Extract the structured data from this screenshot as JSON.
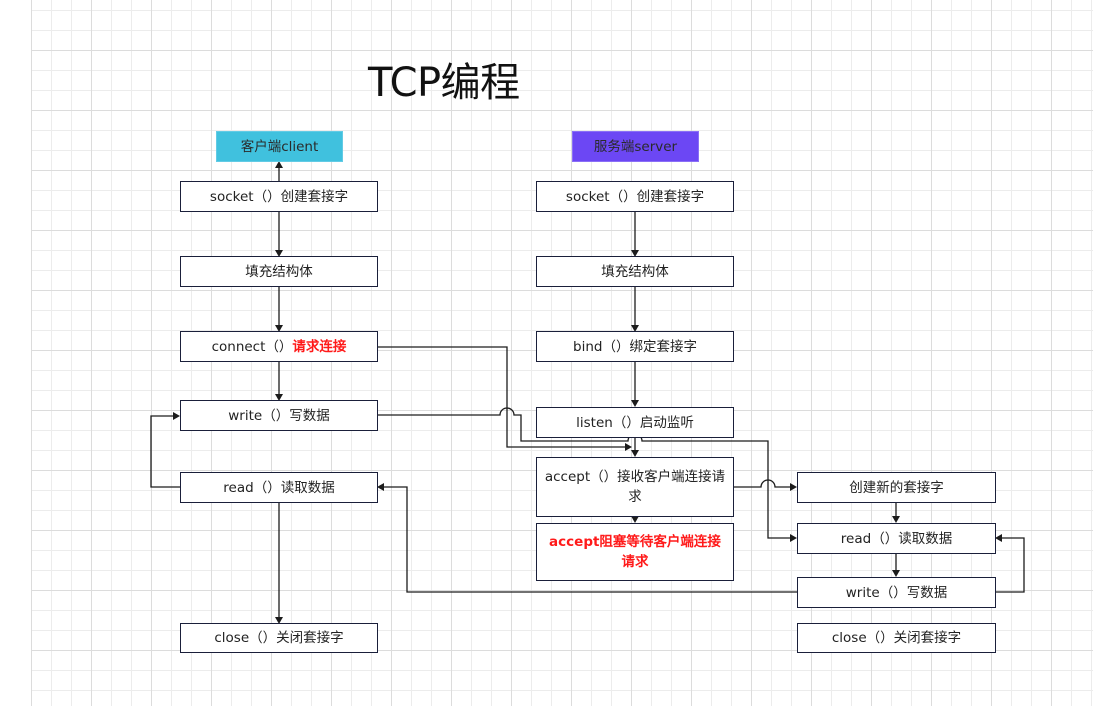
{
  "title": "TCP编程",
  "client": {
    "header": "客户端client",
    "steps": [
      {
        "id": "c-socket",
        "call": "socket（）",
        "desc": "创建套接字"
      },
      {
        "id": "c-fill",
        "call": "",
        "desc": "填充结构体"
      },
      {
        "id": "c-connect",
        "call": "connect（）",
        "desc": "请求连接",
        "highlight": true
      },
      {
        "id": "c-write",
        "call": "write（）",
        "desc": "写数据"
      },
      {
        "id": "c-read",
        "call": "read（）",
        "desc": "读取数据"
      },
      {
        "id": "c-close",
        "call": "close（）",
        "desc": "关闭套接字"
      }
    ]
  },
  "server": {
    "header": "服务端server",
    "steps": [
      {
        "id": "s-socket",
        "call": "socket（）",
        "desc": "创建套接字"
      },
      {
        "id": "s-fill",
        "call": "",
        "desc": "填充结构体"
      },
      {
        "id": "s-bind",
        "call": "bind（）",
        "desc": "绑定套接字"
      },
      {
        "id": "s-listen",
        "call": "listen（）",
        "desc": "启动监听"
      },
      {
        "id": "s-accept",
        "call": "accept（）",
        "desc": "接收客户端连接请求"
      },
      {
        "id": "s-block",
        "call": "",
        "desc": "accept阻塞等待客户端连接请求",
        "highlight": true
      },
      {
        "id": "s-newsock",
        "call": "",
        "desc": "创建新的套接字"
      },
      {
        "id": "s-read",
        "call": "read（）",
        "desc": "读取数据"
      },
      {
        "id": "s-write",
        "call": "write（）",
        "desc": "写数据"
      },
      {
        "id": "s-close",
        "call": "close（）",
        "desc": "关闭套接字"
      }
    ]
  },
  "colors": {
    "client_header": "#40c1de",
    "server_header": "#6c47f4",
    "highlight_text": "#ff1a1a",
    "box_border": "#1a1f3a"
  },
  "edges": [
    {
      "from": "c-socket",
      "to": "client-header"
    },
    {
      "from": "c-socket",
      "to": "c-fill"
    },
    {
      "from": "c-fill",
      "to": "c-connect"
    },
    {
      "from": "c-connect",
      "to": "c-write"
    },
    {
      "from": "c-write",
      "to": "c-read"
    },
    {
      "from": "c-read",
      "to": "c-write"
    },
    {
      "from": "c-read",
      "to": "c-close"
    },
    {
      "from": "c-connect",
      "to": "s-accept"
    },
    {
      "from": "c-write",
      "to": "s-read"
    },
    {
      "from": "s-socket",
      "to": "s-fill"
    },
    {
      "from": "s-fill",
      "to": "s-bind"
    },
    {
      "from": "s-bind",
      "to": "s-listen"
    },
    {
      "from": "s-listen",
      "to": "s-accept"
    },
    {
      "from": "s-accept",
      "to": "s-block"
    },
    {
      "from": "s-accept",
      "to": "s-newsock"
    },
    {
      "from": "s-newsock",
      "to": "s-read"
    },
    {
      "from": "s-read",
      "to": "s-write"
    },
    {
      "from": "s-write",
      "to": "s-read"
    },
    {
      "from": "s-write",
      "to": "c-read"
    }
  ]
}
